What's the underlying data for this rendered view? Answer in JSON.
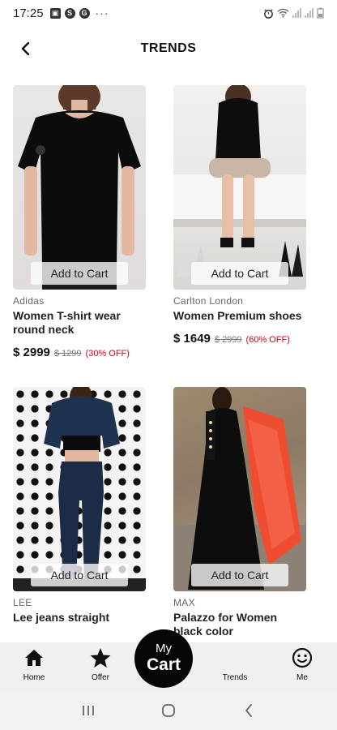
{
  "status_bar": {
    "time": "17:25",
    "icons": [
      "image-icon",
      "skype-icon",
      "g-icon"
    ],
    "overflow": "···",
    "right_icons": [
      "alarm-icon",
      "wifi-icon",
      "signal-icon",
      "signal-icon-2",
      "battery-icon"
    ]
  },
  "header": {
    "back_icon": "chevron-left-icon",
    "title": "TRENDS"
  },
  "products": [
    {
      "brand": "Adidas",
      "name": "Women T-shirt wear round neck",
      "price": "$ 2999",
      "mrp": "$ 1299",
      "discount": "(30% OFF)",
      "add_label": "Add to Cart"
    },
    {
      "brand": "Carlton London",
      "name": "Women Premium shoes",
      "price": "$ 1649",
      "mrp": "$ 2999",
      "discount": "(60% OFF)",
      "add_label": "Add to Cart"
    },
    {
      "brand": "LEE",
      "name": "Lee jeans straight",
      "price": "",
      "mrp": "",
      "discount": "",
      "add_label": "Add to Cart"
    },
    {
      "brand": "MAX",
      "name": "Palazzo for Women black color",
      "price": "",
      "mrp": "",
      "discount": "",
      "add_label": "Add to Cart"
    }
  ],
  "bottom_nav": {
    "home": "Home",
    "offer": "Offer",
    "cart_line1": "My",
    "cart_line2": "Cart",
    "trends": "Trends",
    "me": "Me"
  },
  "colors": {
    "discount": "#d0021b",
    "fab": "#050505",
    "nav_bg": "#f0f0f0"
  }
}
